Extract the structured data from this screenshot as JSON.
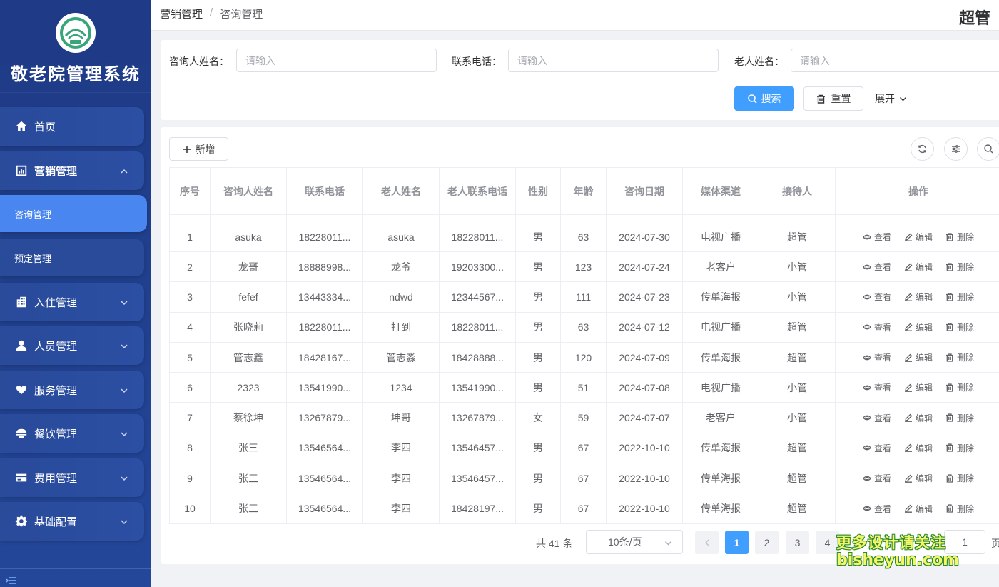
{
  "app": {
    "title": "敬老院管理系统"
  },
  "sidebar": {
    "items": [
      {
        "label": "首页",
        "icon": "home-icon"
      },
      {
        "label": "营销管理",
        "icon": "chart-icon",
        "expanded": true
      },
      {
        "label": "咨询管理",
        "active": true
      },
      {
        "label": "预定管理"
      },
      {
        "label": "入住管理",
        "icon": "building-icon"
      },
      {
        "label": "人员管理",
        "icon": "user-icon"
      },
      {
        "label": "服务管理",
        "icon": "heart-hand-icon"
      },
      {
        "label": "餐饮管理",
        "icon": "bowl-icon"
      },
      {
        "label": "费用管理",
        "icon": "card-icon"
      },
      {
        "label": "基础配置",
        "icon": "gear-icon"
      }
    ]
  },
  "header": {
    "breadcrumb": [
      "营销管理",
      "咨询管理"
    ],
    "user": "超管"
  },
  "search": {
    "fields": [
      {
        "label": "咨询人姓名：",
        "placeholder": "请输入"
      },
      {
        "label": "联系电话：",
        "placeholder": "请输入"
      },
      {
        "label": "老人姓名：",
        "placeholder": "请输入"
      }
    ],
    "search_label": "搜索",
    "reset_label": "重置",
    "expand_label": "展开"
  },
  "toolbar": {
    "add_label": "新增"
  },
  "table": {
    "headers": [
      "序号",
      "咨询人姓名",
      "联系电话",
      "老人姓名",
      "老人联系电话",
      "性别",
      "年龄",
      "咨询日期",
      "媒体渠道",
      "接待人",
      "操作"
    ],
    "ops": {
      "view": "查看",
      "edit": "编辑",
      "delete": "删除"
    },
    "rows": [
      [
        "1",
        "asuka",
        "18228011...",
        "asuka",
        "18228011...",
        "男",
        "63",
        "2024-07-30",
        "电视广播",
        "超管"
      ],
      [
        "2",
        "龙哥",
        "18888998...",
        "龙爷",
        "19203300...",
        "男",
        "123",
        "2024-07-24",
        "老客户",
        "小管"
      ],
      [
        "3",
        "fefef",
        "13443334...",
        "ndwd",
        "12344567...",
        "男",
        "111",
        "2024-07-23",
        "传单海报",
        "小管"
      ],
      [
        "4",
        "张晓莉",
        "18228011...",
        "打到",
        "18228011...",
        "男",
        "63",
        "2024-07-12",
        "电视广播",
        "超管"
      ],
      [
        "5",
        "管志鑫",
        "18428167...",
        "管志淼",
        "18428888...",
        "男",
        "120",
        "2024-07-09",
        "传单海报",
        "超管"
      ],
      [
        "6",
        "2323",
        "13541990...",
        "1234",
        "13541990...",
        "男",
        "51",
        "2024-07-08",
        "电视广播",
        "小管"
      ],
      [
        "7",
        "蔡徐坤",
        "13267879...",
        "坤哥",
        "13267879...",
        "女",
        "59",
        "2024-07-07",
        "老客户",
        "小管"
      ],
      [
        "8",
        "张三",
        "13546564...",
        "李四",
        "13546457...",
        "男",
        "67",
        "2022-10-10",
        "传单海报",
        "超管"
      ],
      [
        "9",
        "张三",
        "13546564...",
        "李四",
        "13546457...",
        "男",
        "67",
        "2022-10-10",
        "传单海报",
        "超管"
      ],
      [
        "10",
        "张三",
        "13546564...",
        "李四",
        "18428197...",
        "男",
        "67",
        "2022-10-10",
        "传单海报",
        "超管"
      ]
    ]
  },
  "pagination": {
    "total_text": "共 41 条",
    "page_size": "10条/页",
    "pages": [
      "1",
      "2",
      "3",
      "4"
    ],
    "current": "1",
    "jump_value": "1",
    "jump_suffix": "页"
  },
  "watermark": {
    "line1": "更多设计请关注",
    "line2": "bisheyun.com"
  },
  "colors": {
    "primary": "#409eff",
    "sidebar": "#1f3a86",
    "active_menu": "#4a86ef"
  }
}
